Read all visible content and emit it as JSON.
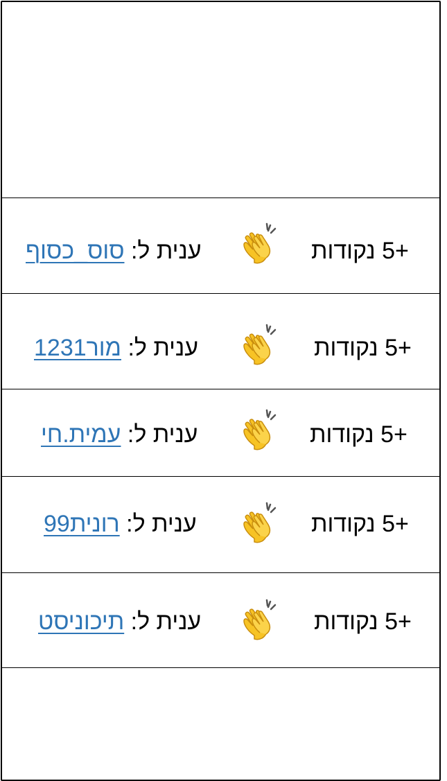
{
  "colors": {
    "link": "#2e75b6",
    "text": "#000000",
    "border": "#000000",
    "clap": "#f7c325"
  },
  "icons": {
    "clap": "clapping-hands-icon"
  },
  "rows": [
    {
      "points": "+5 נקודות",
      "reply_prefix": "ענית ל: ",
      "user": "סוס_כסוף"
    },
    {
      "points": "+5 נקודות",
      "reply_prefix": "ענית ל: ",
      "user": "מור1231"
    },
    {
      "points": "+5 נקודות",
      "reply_prefix": "ענית ל: ",
      "user": "עמית.חי"
    },
    {
      "points": "+5 נקודות",
      "reply_prefix": "ענית ל: ",
      "user": "רונית99"
    },
    {
      "points": "+5 נקודות",
      "reply_prefix": "ענית ל: ",
      "user": "תיכוניסט"
    }
  ]
}
